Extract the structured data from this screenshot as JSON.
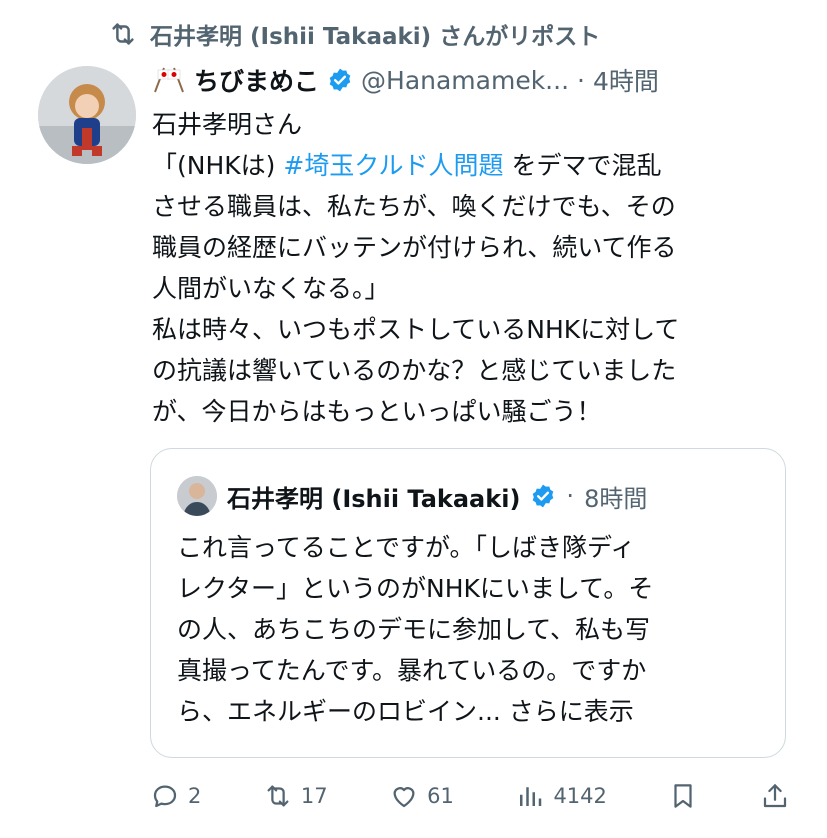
{
  "repost": {
    "text": "石井孝明 (Ishii Takaaki) さんがリポスト"
  },
  "post": {
    "author_name": "ちびまめこ",
    "handle": "@Hanamamek...",
    "separator": "·",
    "time": "4時間",
    "lines": [
      "石井孝明さん",
      "「(NHKは)",
      "#埼玉クルド人問題",
      "をデマで混乱",
      "させる職員は、私たちが、喚くだけでも、その",
      "職員の経歴にバッテンが付けられ、続いて作る",
      "人間がいなくなる。」",
      "私は時々、いつもポストしているNHKに対して",
      "の抗議は響いているのかな？と感じていました",
      "が、今日からはもっといっぱい騒ごう！"
    ]
  },
  "quote": {
    "author_name": "石井孝明 (Ishii Takaaki)",
    "separator": "·",
    "time": "8時間",
    "lines": [
      "これ言ってることですが。「しばき隊ディ",
      "レクター」というのがNHKにいまして。そ",
      "の人、あちこちのデモに参加して、私も写",
      "真撮ってたんです。暴れているの。ですか",
      "ら、エネルギーのロビイン... さらに表示"
    ]
  },
  "actions": {
    "reply_count": "2",
    "repost_count": "17",
    "like_count": "61",
    "views_count": "4142"
  },
  "colors": {
    "accent": "#1d9bf0",
    "secondary": "#536471",
    "border": "#cfd9de"
  }
}
